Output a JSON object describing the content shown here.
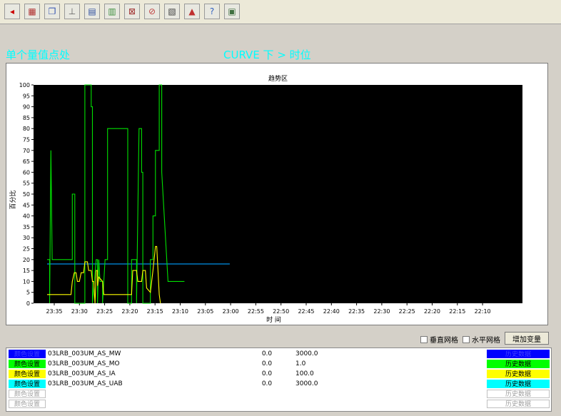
{
  "toolbar": {
    "buttons": [
      {
        "icon": "arrow-left-icon",
        "color": "#cc0000"
      },
      {
        "icon": "grid-window-icon",
        "color": "#b03030"
      },
      {
        "icon": "window-cascade-icon",
        "color": "#3050b0"
      },
      {
        "icon": "hierarchy-icon",
        "color": "#606060"
      },
      {
        "icon": "chart-page-icon",
        "color": "#3050a0"
      },
      {
        "icon": "building-icon",
        "color": "#409040"
      },
      {
        "icon": "filter-icon",
        "color": "#a03030"
      },
      {
        "icon": "forbidden-icon",
        "color": "#c04040"
      },
      {
        "icon": "document-icon",
        "color": "#404040"
      },
      {
        "icon": "triangle-warning-icon",
        "color": "#c03030"
      },
      {
        "icon": "help-icon",
        "color": "#3060c0"
      },
      {
        "icon": "table-icon",
        "color": "#407040"
      }
    ]
  },
  "header": {
    "left_title": "单个量值点处",
    "right_title": "CURVE 下 > 时位"
  },
  "chart_data": {
    "type": "line",
    "title": "趋势区",
    "ylabel": "百分比",
    "xlabel": "时 间",
    "ylim": [
      0,
      100
    ],
    "yticks": [
      "0",
      "5",
      "10",
      "15",
      "20",
      "25",
      "30",
      "35",
      "40",
      "45",
      "50",
      "55",
      "60",
      "65",
      "70",
      "75",
      "80",
      "85",
      "90",
      "95",
      "100"
    ],
    "xticks": [
      "23:35",
      "23:30",
      "23:25",
      "23:20",
      "23:15",
      "23:10",
      "23:05",
      "23:00",
      "22:55",
      "22:50",
      "22:45",
      "22:40",
      "22:35",
      "22:30",
      "22:25",
      "22:20",
      "22:15",
      "22:10"
    ],
    "grid": false,
    "series": [
      {
        "name": "03LRB_003UM_AS_MW",
        "color": "#00a0ff",
        "points": [
          [
            0,
            18
          ],
          [
            1.28,
            18
          ],
          [
            1.28,
            18
          ],
          [
            2.8,
            18
          ],
          [
            3.8,
            18
          ],
          [
            4.6,
            18
          ],
          [
            5.4,
            18
          ],
          [
            6.6,
            18
          ],
          [
            7.25,
            18
          ]
        ]
      },
      {
        "name": "03LRB_003UM_AS_MO",
        "color": "#00e000",
        "points": [
          [
            0,
            20
          ],
          [
            0.1,
            20
          ],
          [
            0.1,
            0
          ],
          [
            0.15,
            70
          ],
          [
            0.2,
            20
          ],
          [
            1,
            20
          ],
          [
            1,
            50
          ],
          [
            1.1,
            50
          ],
          [
            1.1,
            0
          ],
          [
            1.25,
            0
          ],
          [
            1.5,
            0
          ],
          [
            1.5,
            100
          ],
          [
            1.75,
            100
          ],
          [
            1.75,
            90
          ],
          [
            1.8,
            90
          ],
          [
            1.8,
            0
          ],
          [
            1.95,
            20
          ],
          [
            2,
            20
          ],
          [
            2,
            0
          ],
          [
            2.05,
            20
          ],
          [
            2.1,
            10
          ],
          [
            2.2,
            10
          ],
          [
            2.2,
            0
          ],
          [
            2.3,
            20
          ],
          [
            2.4,
            20
          ],
          [
            2.4,
            80
          ],
          [
            3.2,
            80
          ],
          [
            3.2,
            0
          ],
          [
            3.35,
            0
          ],
          [
            3.35,
            20
          ],
          [
            3.55,
            20
          ],
          [
            3.55,
            0
          ],
          [
            3.65,
            80
          ],
          [
            3.75,
            80
          ],
          [
            3.75,
            60
          ],
          [
            3.8,
            60
          ],
          [
            3.8,
            0
          ],
          [
            4,
            0
          ],
          [
            4.1,
            0
          ],
          [
            4.1,
            20
          ],
          [
            4.2,
            20
          ],
          [
            4.2,
            40
          ],
          [
            4.3,
            40
          ],
          [
            4.3,
            70
          ],
          [
            4.45,
            70
          ],
          [
            4.45,
            100
          ],
          [
            4.55,
            100
          ],
          [
            4.55,
            60
          ],
          [
            4.8,
            10
          ],
          [
            5.45,
            10
          ]
        ]
      },
      {
        "name": "03LRB_003UM_AS_IA",
        "color": "#ffff00",
        "points": [
          [
            0,
            4
          ],
          [
            0.95,
            4
          ],
          [
            1,
            10
          ],
          [
            1.08,
            14
          ],
          [
            1.15,
            14
          ],
          [
            1.2,
            10
          ],
          [
            1.28,
            10
          ],
          [
            1.35,
            14
          ],
          [
            1.45,
            14
          ],
          [
            1.5,
            19
          ],
          [
            1.6,
            19
          ],
          [
            1.65,
            15
          ],
          [
            1.75,
            15
          ],
          [
            1.8,
            10
          ],
          [
            1.85,
            10
          ],
          [
            1.9,
            0
          ],
          [
            1.95,
            15
          ],
          [
            2,
            15
          ],
          [
            2,
            8
          ],
          [
            2.05,
            12
          ],
          [
            2.2,
            10
          ],
          [
            2.25,
            4
          ],
          [
            3.35,
            4
          ],
          [
            3.4,
            15
          ],
          [
            3.55,
            15
          ],
          [
            3.6,
            10
          ],
          [
            3.75,
            10
          ],
          [
            3.8,
            15
          ],
          [
            3.9,
            15
          ],
          [
            3.95,
            7
          ],
          [
            4.1,
            5
          ],
          [
            4.2,
            15
          ],
          [
            4.3,
            26
          ],
          [
            4.35,
            26
          ],
          [
            4.45,
            4
          ],
          [
            4.5,
            0
          ]
        ]
      },
      {
        "name": "03LRB_003UM_AS_UAB",
        "color": "#00ffff",
        "points": []
      }
    ]
  },
  "controls": {
    "vertical_grid_label": "垂直网格",
    "horizontal_grid_label": "水平网格",
    "add_variable_label": "增加变量"
  },
  "variables": [
    {
      "color_label": "颜色设置",
      "color": "#0000ff",
      "text_color": "#4040ff",
      "name": "03LRB_003UM_AS_MW",
      "min": "0.0",
      "max": "3000.0",
      "hist_label": "历史数据"
    },
    {
      "color_label": "颜色设置",
      "color": "#00ff00",
      "text_color": "#000000",
      "name": "03LRB_003UM_AS_MO",
      "min": "0.0",
      "max": "1.0",
      "hist_label": "历史数据"
    },
    {
      "color_label": "颜色设置",
      "color": "#ffff00",
      "text_color": "#000000",
      "name": "03LRB_003UM_AS_IA",
      "min": "0.0",
      "max": "100.0",
      "hist_label": "历史数据"
    },
    {
      "color_label": "颜色设置",
      "color": "#00ffff",
      "text_color": "#000000",
      "name": "03LRB_003UM_AS_UAB",
      "min": "0.0",
      "max": "3000.0",
      "hist_label": "历史数据"
    },
    {
      "color_label": "颜色设置",
      "color": "#ffffff",
      "text_color": "#a0a0a0",
      "name": "",
      "min": "",
      "max": "",
      "hist_label": "历史数据"
    },
    {
      "color_label": "颜色设置",
      "color": "#ffffff",
      "text_color": "#a0a0a0",
      "name": "",
      "min": "",
      "max": "",
      "hist_label": "历史数据"
    }
  ]
}
